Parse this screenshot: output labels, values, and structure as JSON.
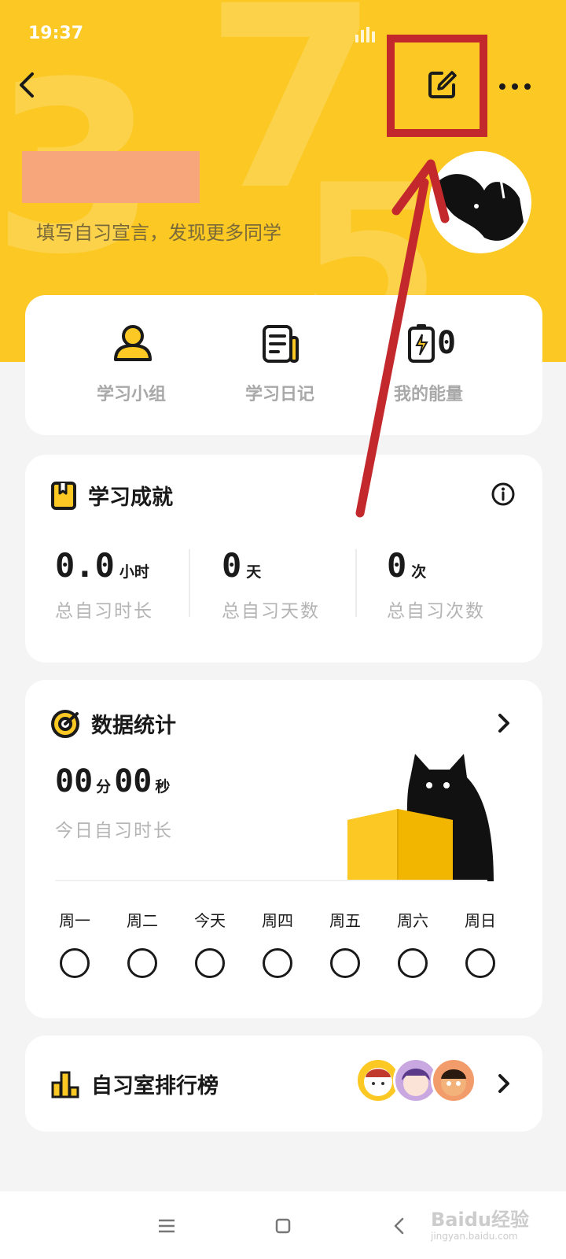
{
  "status_bar": {
    "time": "19:37"
  },
  "header": {
    "signature_placeholder": "填写自习宣言，发现更多同学"
  },
  "shortcuts": [
    {
      "label": "学习小组",
      "icon": "group-icon"
    },
    {
      "label": "学习日记",
      "icon": "diary-icon"
    },
    {
      "label": "我的能量",
      "icon": "battery-icon",
      "value": "0"
    }
  ],
  "achievements": {
    "title": "学习成就",
    "stats": [
      {
        "value": "0.0",
        "unit": "小时",
        "label": "总自习时长"
      },
      {
        "value": "0",
        "unit": "天",
        "label": "总自习天数"
      },
      {
        "value": "0",
        "unit": "次",
        "label": "总自习次数"
      }
    ]
  },
  "statistics": {
    "title": "数据统计",
    "minutes": "00",
    "minutes_unit": "分",
    "seconds": "00",
    "seconds_unit": "秒",
    "label": "今日自习时长",
    "days": [
      "周一",
      "周二",
      "今天",
      "周四",
      "周五",
      "周六",
      "周日"
    ]
  },
  "ranking": {
    "title": "自习室排行榜"
  },
  "watermark": {
    "main": "Baidu经验",
    "sub": "jingyan.baidu.com"
  },
  "colors": {
    "brand_yellow": "#fcc823",
    "highlight_red": "#c2282c",
    "redact": "#f7a57a"
  }
}
